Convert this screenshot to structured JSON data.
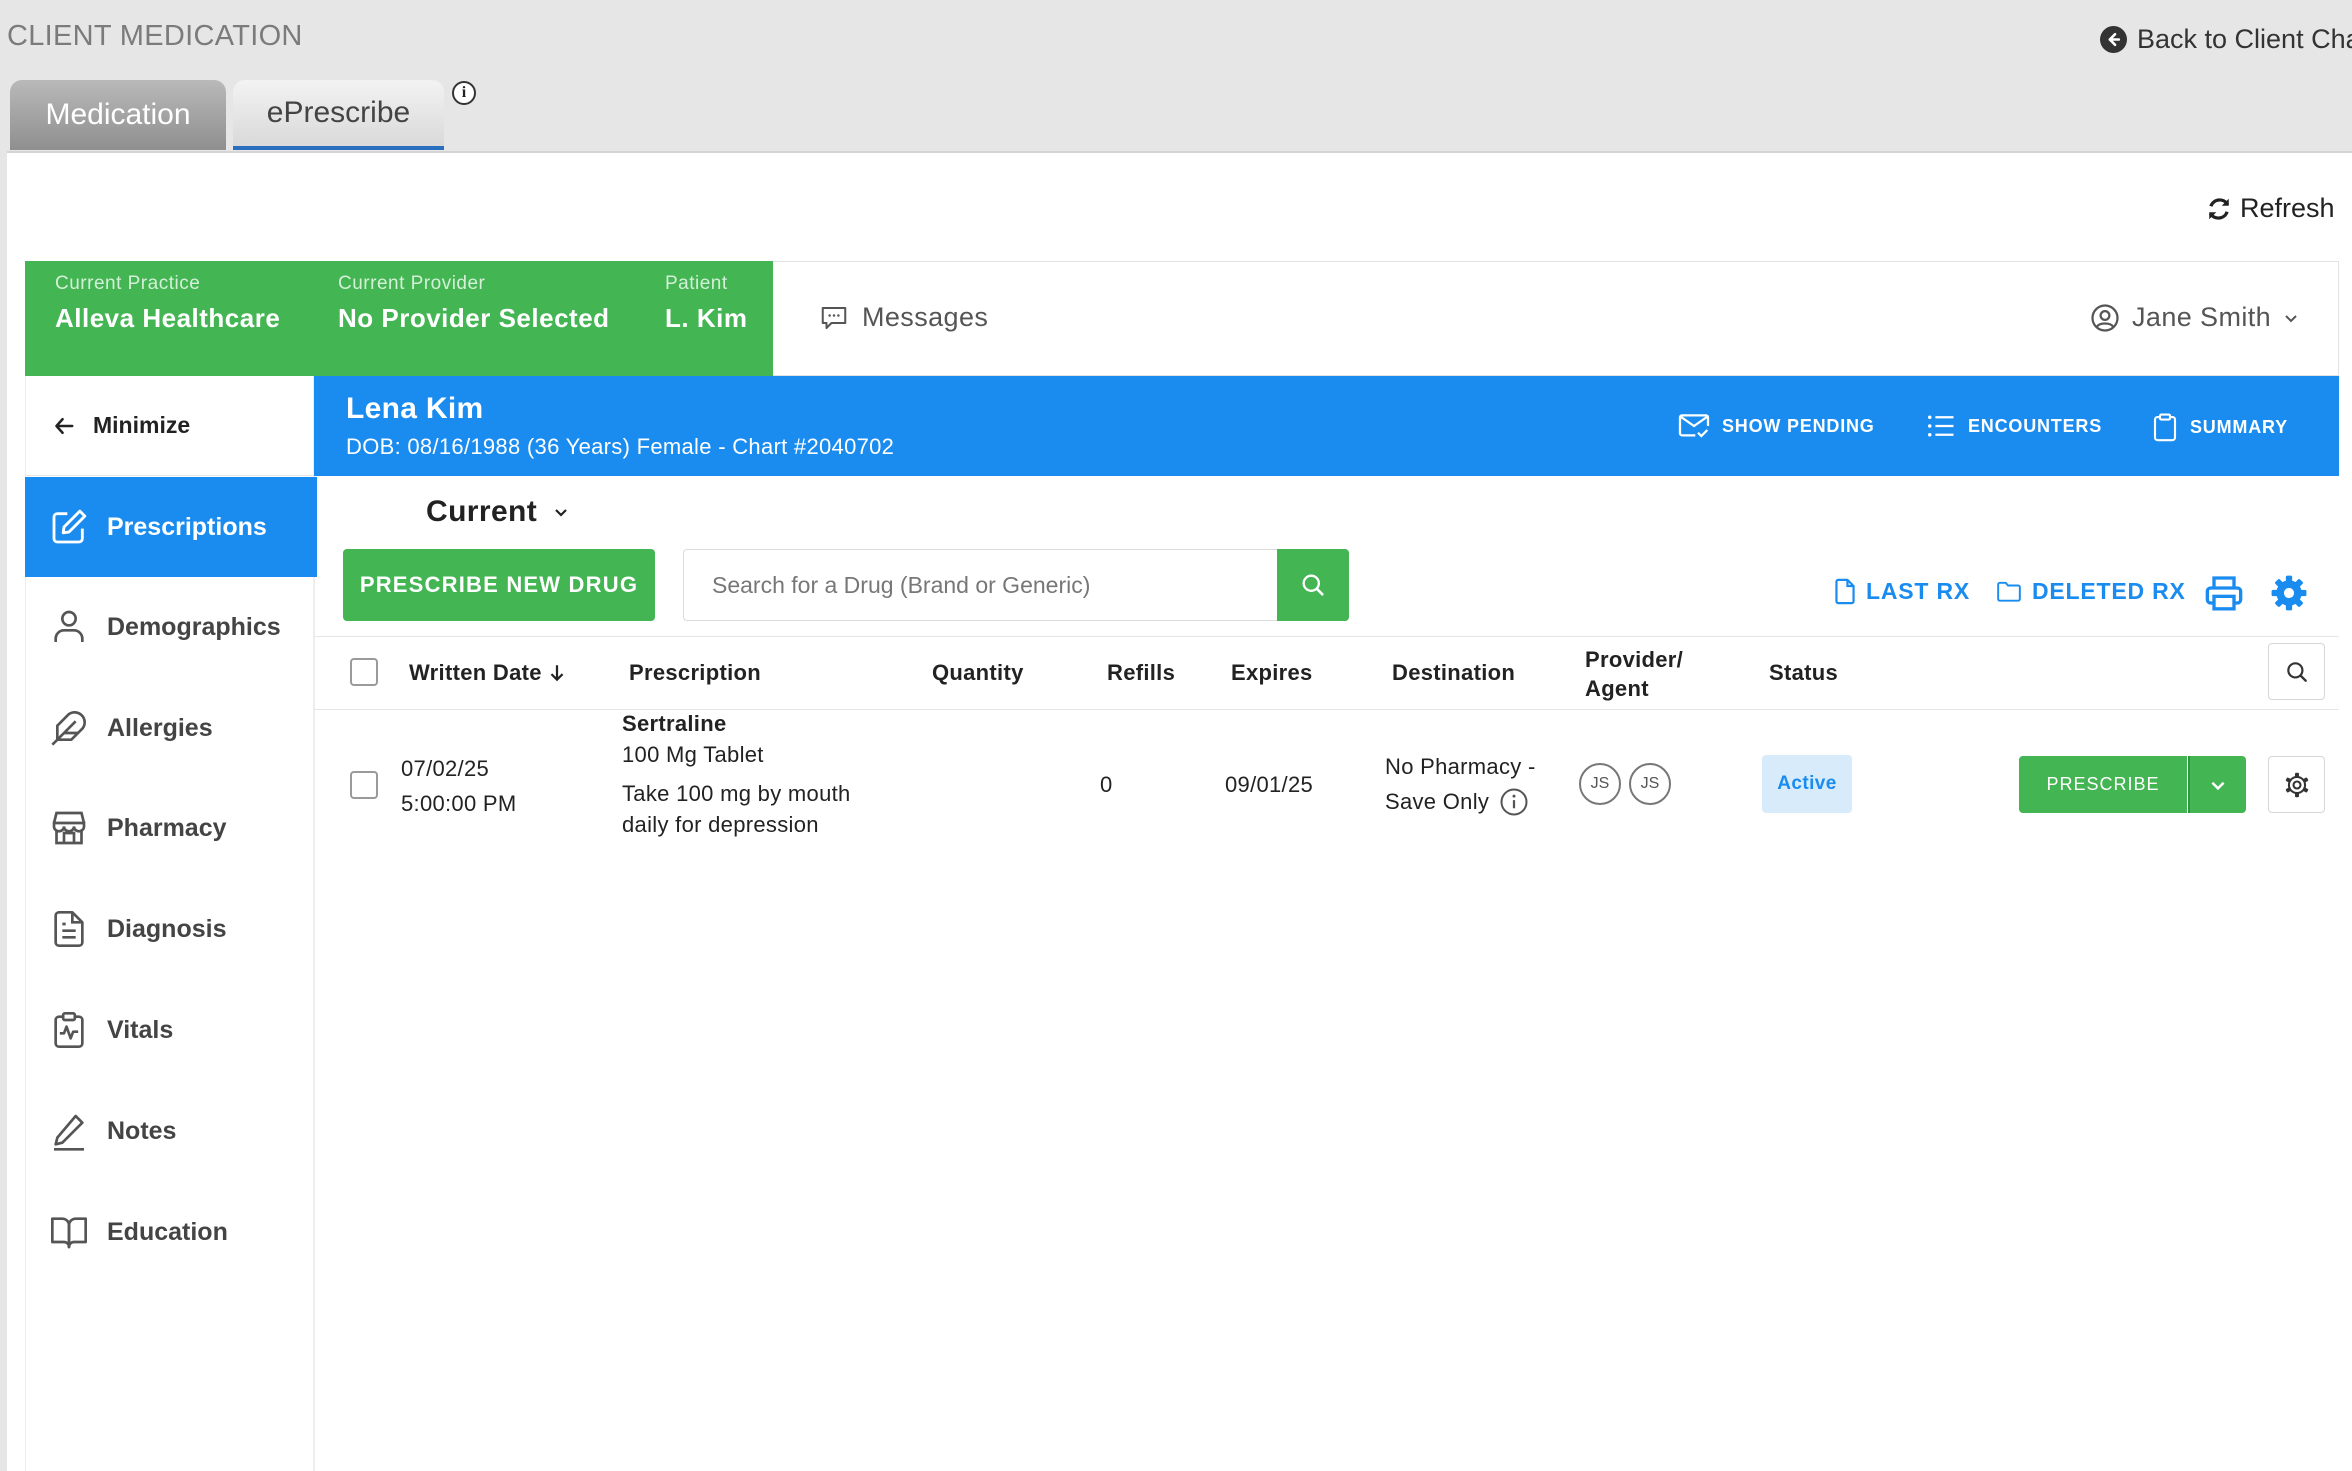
{
  "header": {
    "title": "CLIENT MEDICATION",
    "back_link": "Back to Client Char",
    "tabs": [
      {
        "label": "Medication"
      },
      {
        "label": "ePrescribe"
      }
    ],
    "info_badge": "i"
  },
  "toolbar": {
    "refresh_label": "Refresh"
  },
  "context": {
    "practice_label": "Current Practice",
    "practice_value": "Alleva Healthcare",
    "provider_label": "Current Provider",
    "provider_value": "No Provider Selected",
    "patient_label": "Patient",
    "patient_value": "L. Kim",
    "messages_label": "Messages",
    "user_name": "Jane Smith"
  },
  "sidebar": {
    "minimize_label": "Minimize",
    "items": [
      {
        "label": "Prescriptions",
        "icon": "edit-square-icon",
        "active": true
      },
      {
        "label": "Demographics",
        "icon": "person-icon"
      },
      {
        "label": "Allergies",
        "icon": "feather-icon"
      },
      {
        "label": "Pharmacy",
        "icon": "store-icon"
      },
      {
        "label": "Diagnosis",
        "icon": "document-icon"
      },
      {
        "label": "Vitals",
        "icon": "clipboard-pulse-icon"
      },
      {
        "label": "Notes",
        "icon": "pencil-icon"
      },
      {
        "label": "Education",
        "icon": "book-icon"
      }
    ]
  },
  "patient": {
    "name": "Lena Kim",
    "info": "DOB: 08/16/1988 (36 Years) Female - Chart #2040702",
    "actions": {
      "show_pending": "SHOW PENDING",
      "encounters": "ENCOUNTERS",
      "summary": "SUMMARY"
    }
  },
  "main": {
    "filter_label": "Current",
    "prescribe_new_label": "PRESCRIBE NEW DRUG",
    "search_placeholder": "Search for a Drug (Brand or Generic)",
    "last_rx_label": "LAST RX",
    "deleted_rx_label": "DELETED RX"
  },
  "table": {
    "columns": {
      "written_date": "Written Date",
      "prescription": "Prescription",
      "quantity": "Quantity",
      "refills": "Refills",
      "expires": "Expires",
      "destination": "Destination",
      "provider_line1": "Provider/",
      "provider_line2": "Agent",
      "status": "Status"
    },
    "rows": [
      {
        "date": "07/02/25",
        "time": "5:00:00 PM",
        "drug": "Sertraline",
        "form": "100 Mg Tablet",
        "sig_line1": "Take 100 mg by mouth",
        "sig_line2": "daily for depression",
        "quantity": "",
        "refills": "0",
        "expires": "09/01/25",
        "destination_line1": "No Pharmacy -",
        "destination_line2": "Save Only",
        "provider_initials": "JS",
        "agent_initials": "JS",
        "status": "Active",
        "action_label": "PRESCRIBE"
      }
    ]
  },
  "colors": {
    "green": "#43b553",
    "blue": "#1a8cf0",
    "status_bg": "#d8ebfb"
  }
}
